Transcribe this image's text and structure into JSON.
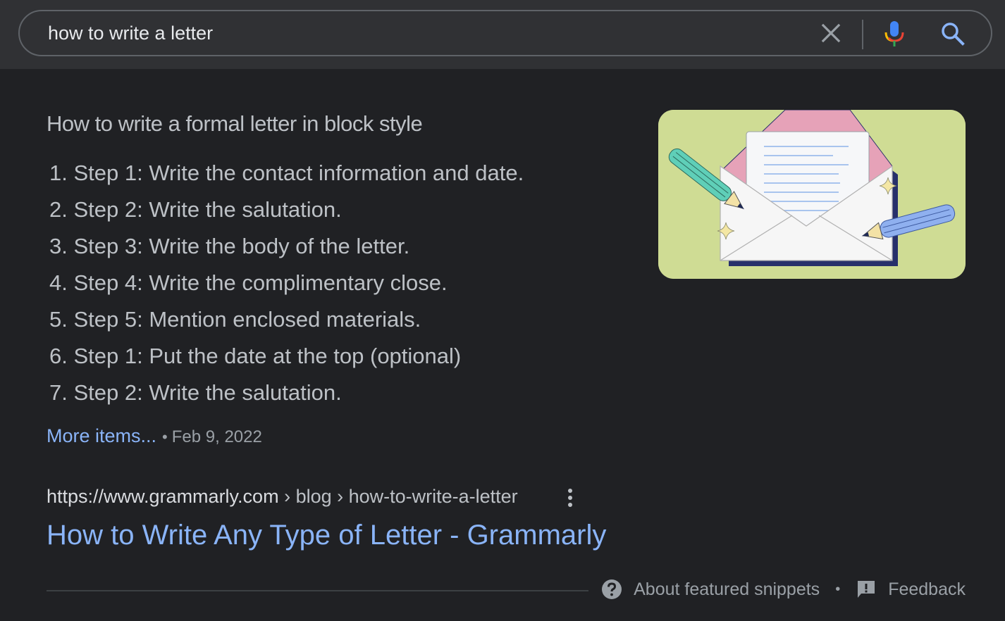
{
  "search": {
    "query": "how to write a letter",
    "clear_icon": "close-icon",
    "voice_icon": "microphone-icon",
    "search_icon": "search-icon"
  },
  "snippet": {
    "heading": "How to write a formal letter in block style",
    "steps": [
      "1. Step 1: Write the contact information and date.",
      "2. Step 2: Write the salutation.",
      "3. Step 3: Write the body of the letter.",
      "4. Step 4: Write the complimentary close.",
      "5. Step 5: Mention enclosed materials.",
      "6. Step 1: Put the date at the top (optional)",
      "7. Step 2: Write the salutation."
    ],
    "more_items_label": "More items...",
    "separator": "•",
    "date": "Feb 9, 2022",
    "image": "envelope-letter-illustration"
  },
  "result": {
    "cite_domain": "https://www.grammarly.com",
    "cite_path": " › blog › how-to-write-a-letter",
    "title": "How to Write Any Type of Letter - Grammarly"
  },
  "footer": {
    "about_label": "About featured snippets",
    "separator": "•",
    "feedback_label": "Feedback"
  },
  "colors": {
    "background": "#202124",
    "topbar": "#303134",
    "link": "#8ab4f8",
    "text": "#bdc1c6",
    "muted": "#9aa0a6"
  }
}
